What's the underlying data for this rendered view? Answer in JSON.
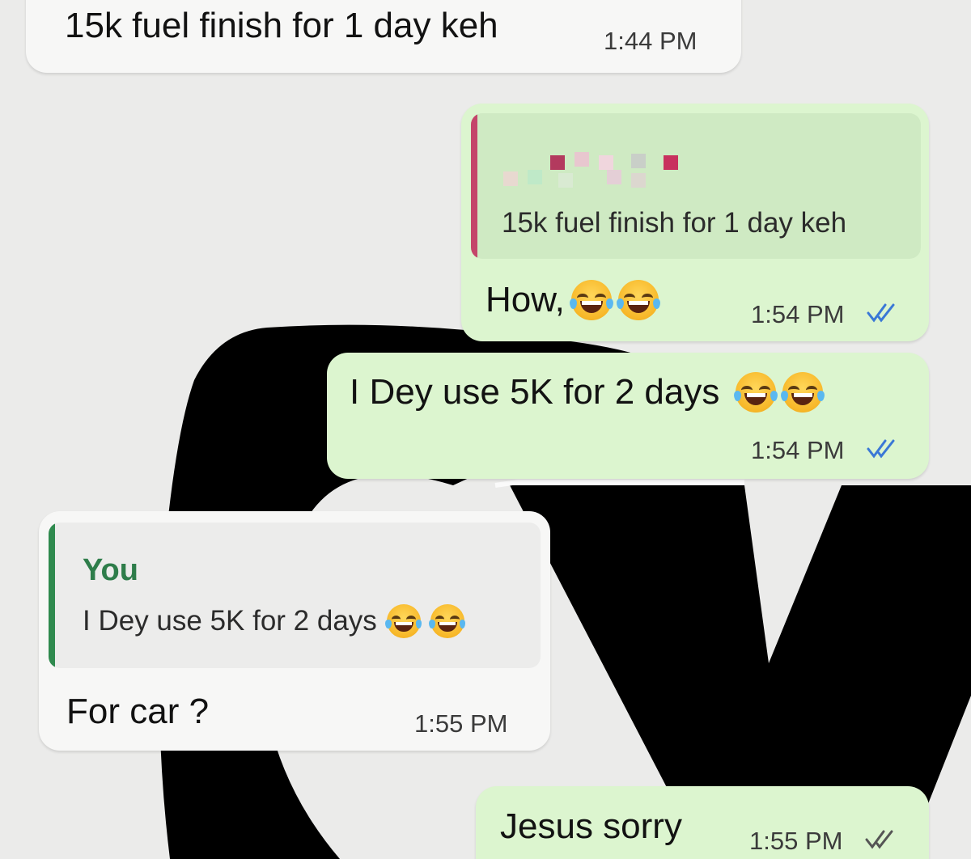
{
  "messages": [
    {
      "text": "15k fuel finish for 1 day keh",
      "time": "1:44 PM"
    },
    {
      "quote": {
        "text": "15k fuel finish for 1 day keh"
      },
      "text": "How,",
      "time": "1:54 PM"
    },
    {
      "text": "I Dey use 5K for 2 days",
      "time": "1:54 PM"
    },
    {
      "quote": {
        "author": "You",
        "text": "I Dey use 5K for 2 days"
      },
      "text": "For car ?",
      "time": "1:55 PM"
    },
    {
      "text": "Jesus sorry",
      "time": "1:55 PM"
    }
  ],
  "colors": {
    "incoming_bubble": "#f7f7f6",
    "outgoing_bubble": "#dcf5cf",
    "quote_bar_pink": "#c4456a",
    "quote_bar_green": "#2f8a4e",
    "you_label": "#2e7d4a",
    "read_ticks": "#3a78d6",
    "sent_ticks": "#555555"
  },
  "icons": {
    "emoji": "face-with-tears-of-joy",
    "read_receipt": "double-check-icon"
  }
}
